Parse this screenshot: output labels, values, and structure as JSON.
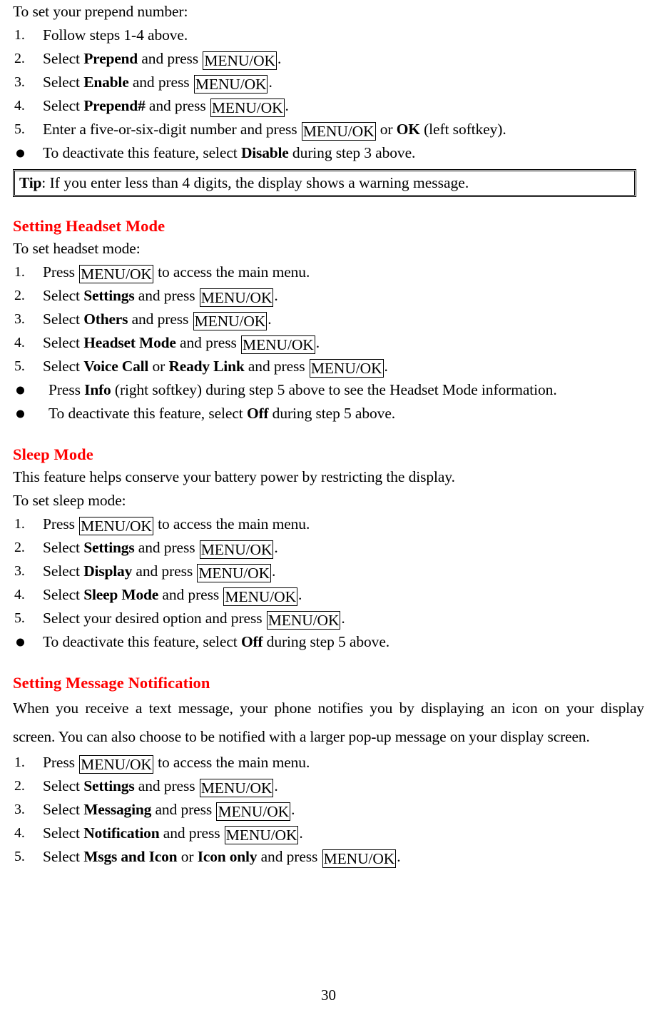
{
  "page": {
    "number": "30",
    "heading_color": "#ff0000"
  },
  "prepend": {
    "intro": "To set your prepend number:",
    "steps": [
      {
        "num": "1.",
        "pre": "Follow steps 1-4 above.",
        "bold1": "",
        "mid": "",
        "key": "",
        "post": ""
      },
      {
        "num": "2.",
        "pre": "Select ",
        "bold1": "Prepend",
        "mid": " and press ",
        "key": "MENU/OK",
        "post": "."
      },
      {
        "num": "3.",
        "pre": "Select ",
        "bold1": "Enable",
        "mid": " and press ",
        "key": "MENU/OK",
        "post": "."
      },
      {
        "num": "4.",
        "pre": "Select ",
        "bold1": "Prepend#",
        "mid": " and press ",
        "key": "MENU/OK",
        "post": "."
      },
      {
        "num": "5.",
        "pre": "Enter a five-or-six-digit number and press ",
        "bold1": "",
        "mid": "",
        "key": "MENU/OK",
        "post": " or ",
        "bold2": "OK",
        "tail": " (left softkey)."
      }
    ],
    "bullet": {
      "pre": "To deactivate this feature, select ",
      "bold": "Disable",
      "post": " during step 3 above."
    },
    "tip": {
      "label": "Tip",
      "text": ": If you enter less than 4 digits, the display shows a warning message."
    }
  },
  "headset": {
    "heading": "Setting Headset Mode",
    "intro": "To set headset mode:",
    "steps": [
      {
        "num": "1.",
        "pre": "Press ",
        "key": "MENU/OK",
        "post": " to access the main menu."
      },
      {
        "num": "2.",
        "pre": "Select ",
        "bold1": "Settings",
        "mid": " and press ",
        "key": "MENU/OK",
        "post": "."
      },
      {
        "num": "3.",
        "pre": "Select ",
        "bold1": "Others",
        "mid": " and press ",
        "key": "MENU/OK",
        "post": "."
      },
      {
        "num": "4.",
        "pre": "Select ",
        "bold1": "Headset Mode",
        "mid": " and press ",
        "key": "MENU/OK",
        "post": "."
      },
      {
        "num": "5.",
        "pre": "Select ",
        "bold1": "Voice Call",
        "mid": " or ",
        "bold2": "Ready Link",
        "mid2": " and press ",
        "key": "MENU/OK",
        "post": "."
      }
    ],
    "bullets": [
      {
        "pre": " Press ",
        "bold": "Info",
        "post": " (right softkey) during step 5 above to see the Headset Mode information."
      },
      {
        "pre": " To deactivate this feature, select ",
        "bold": "Off",
        "post": " during step 5 above."
      }
    ]
  },
  "sleep": {
    "heading": "Sleep Mode",
    "desc": "This feature helps conserve your battery power by restricting the display.",
    "intro": "To set sleep mode:",
    "steps": [
      {
        "num": "1.",
        "pre": "Press ",
        "key": "MENU/OK",
        "post": " to access the main menu."
      },
      {
        "num": "2.",
        "pre": "Select ",
        "bold1": "Settings",
        "mid": " and press ",
        "key": "MENU/OK",
        "post": "."
      },
      {
        "num": "3.",
        "pre": "Select ",
        "bold1": "Display",
        "mid": " and press ",
        "key": "MENU/OK",
        "post": "."
      },
      {
        "num": "4.",
        "pre": "Select ",
        "bold1": "Sleep Mode",
        "mid": " and press ",
        "key": "MENU/OK",
        "post": "."
      },
      {
        "num": "5.",
        "pre": "Select your desired option and press ",
        "key": "MENU/OK",
        "post": "."
      }
    ],
    "bullet": {
      "pre": "To deactivate this feature, select ",
      "bold": "Off",
      "post": " during step 5 above."
    }
  },
  "notification": {
    "heading": "Setting Message Notification",
    "para_line1": "When you receive a text message, your phone notifies you by displaying an icon on your display",
    "para_line2": "screen. You can also choose to be notified with a larger pop-up message on your display screen.",
    "steps": [
      {
        "num": "1.",
        "pre": "Press ",
        "key": "MENU/OK",
        "post": " to access the main menu."
      },
      {
        "num": "2.",
        "pre": "Select ",
        "bold1": "Settings",
        "mid": " and press ",
        "key": "MENU/OK",
        "post": "."
      },
      {
        "num": "3.",
        "pre": "Select ",
        "bold1": "Messaging",
        "mid": " and press ",
        "key": "MENU/OK",
        "post": "."
      },
      {
        "num": "4.",
        "pre": "Select ",
        "bold1": "Notification",
        "mid": " and press ",
        "key": "MENU/OK",
        "post": "."
      },
      {
        "num": "5.",
        "pre": "Select ",
        "bold1": "Msgs and Icon",
        "mid": " or ",
        "bold2": "Icon only",
        "mid2": " and press ",
        "key": "MENU/OK",
        "post": "."
      }
    ]
  }
}
